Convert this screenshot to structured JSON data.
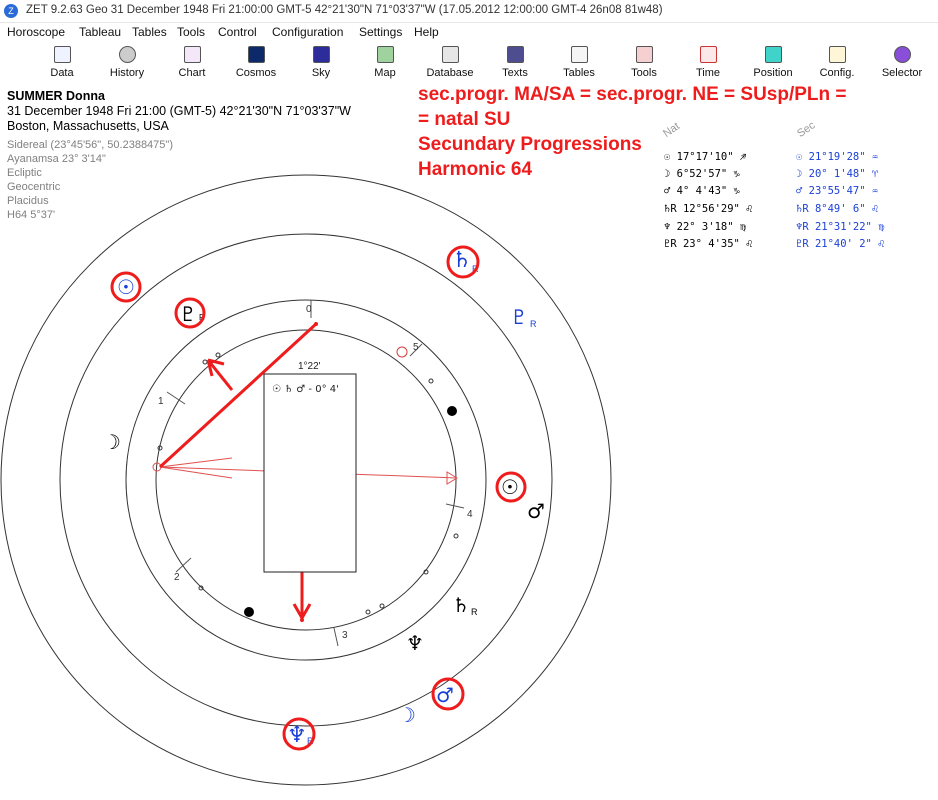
{
  "window": {
    "title": "ZET 9.2.63 Geo   31 December 1948  Fri  21:00:00 GMT-5 42°21'30\"N  71°03'37\"W  (17.05.2012  12:00:00 GMT-4 26n08 81w48)"
  },
  "menu": [
    "Horoscope",
    "Tableau",
    "Tables",
    "Tools",
    "Control",
    "Configuration",
    "Settings",
    "Help"
  ],
  "toolbar": [
    "Data",
    "History",
    "Chart",
    "Cosmos",
    "Sky",
    "Map",
    "Database",
    "Texts",
    "Tables",
    "Tools",
    "Time",
    "Position",
    "Config.",
    "Selector"
  ],
  "person": {
    "name": "SUMMER Donna",
    "datetime": "31 December 1948  Fri  21:00 (GMT-5) 42°21'30\"N  71°03'37\"W",
    "place": "Boston, Massachusetts, USA"
  },
  "settings": [
    "Sidereal (23°45'56\", 50.2388475\")",
    "Ayanamsa 23° 3'14\"",
    "Ecliptic",
    "Geocentric",
    "Placidus",
    "H64   5°37'"
  ],
  "annotation": [
    "sec.progr. MA/SA = sec.progr. NE = SUsp/PLn =",
    "= natal SU",
    "Secundary Progressions",
    "Harmonic 64"
  ],
  "positions": {
    "nat_header": "Nat",
    "sec_header": "Sec",
    "rows": [
      {
        "nat": "☉   17°17'10\" ♐",
        "sec": "☉   21°19'28\" ♒"
      },
      {
        "nat": "☽    6°52'57\" ♑",
        "sec": "☽   20° 1'48\" ♈"
      },
      {
        "nat": "♂    4° 4'43\" ♑",
        "sec": "♂   23°55'47\" ♒"
      },
      {
        "nat": "♄R  12°56'29\" ♌",
        "sec": "♄R   8°49' 6\" ♌"
      },
      {
        "nat": "♆   22° 3'18\" ♍",
        "sec": "♆R  21°31'22\" ♍"
      },
      {
        "nat": "♇R  23° 4'35\" ♌",
        "sec": "♇R  21°40' 2\" ♌"
      }
    ]
  },
  "wheel": {
    "house_numbers": [
      "0",
      "1",
      "2",
      "3",
      "4",
      "5"
    ],
    "arc_label": "1°22'",
    "aspect_box": "☉ ♄ ♂ - 0° 4'",
    "planets_outer": [
      {
        "glyph": "☉",
        "name": "sun-outer-nw",
        "color": "#1a3fd8"
      },
      {
        "glyph": "♄",
        "sub": "R",
        "name": "saturn-outer",
        "color": "#1a3fd8"
      },
      {
        "glyph": "♇",
        "sub": "R",
        "name": "pluto-outer",
        "color": "#1a3fd8"
      },
      {
        "glyph": "♂",
        "name": "mars-outer",
        "color": "#1a3fd8"
      },
      {
        "glyph": "☽",
        "name": "moon-outer",
        "color": "#1a3fd8"
      },
      {
        "glyph": "♆",
        "sub": "R",
        "name": "neptune-outer",
        "color": "#1a3fd8"
      }
    ],
    "planets_inner": [
      {
        "glyph": "♇",
        "sub": "R",
        "name": "pluto-inner",
        "color": "#000000"
      },
      {
        "glyph": "☽",
        "name": "moon-inner",
        "color": "#000000"
      },
      {
        "glyph": "☉",
        "name": "sun-inner",
        "color": "#000000"
      },
      {
        "glyph": "♂",
        "name": "mars-inner",
        "color": "#000000"
      },
      {
        "glyph": "♄",
        "sub": "R",
        "name": "saturn-inner",
        "color": "#000000"
      },
      {
        "glyph": "♆",
        "name": "neptune-inner",
        "color": "#000000"
      }
    ]
  },
  "colors": {
    "annotation_red": "#ee1c1c",
    "secondary_blue": "#1a3fd8",
    "axis_red": "#e05050"
  }
}
